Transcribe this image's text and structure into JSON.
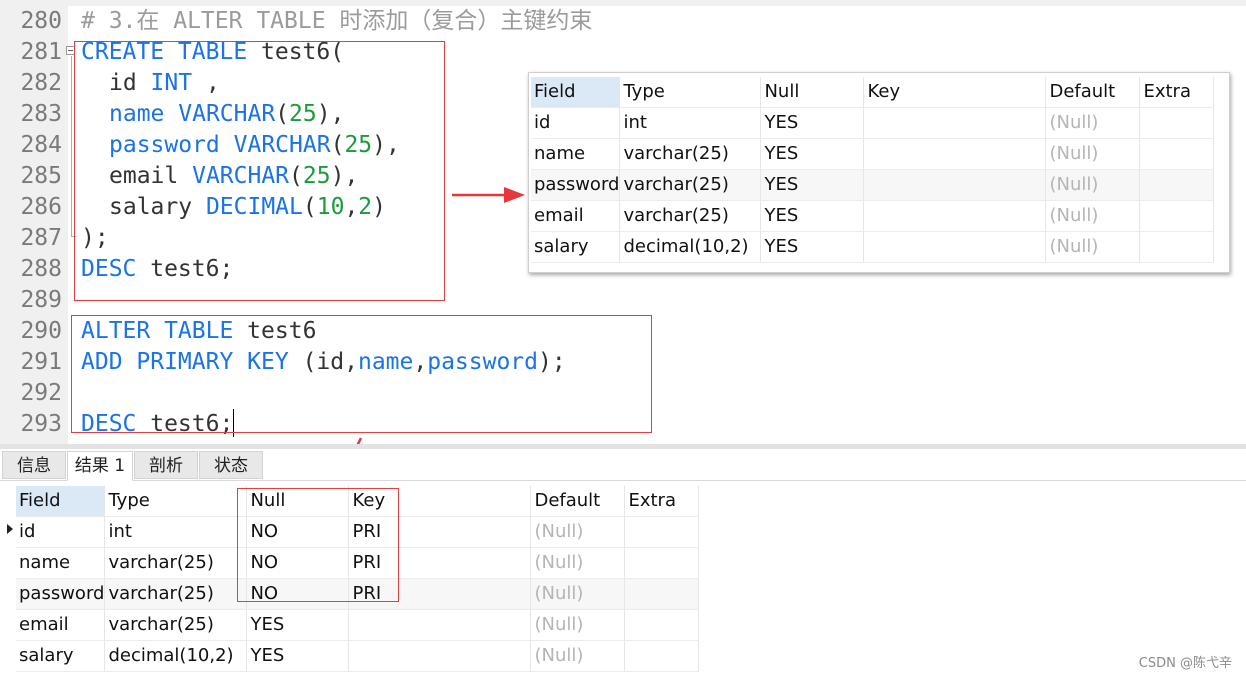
{
  "editor": {
    "lines": [
      {
        "num": "280",
        "parts": [
          {
            "t": "# 3.在 ALTER TABLE 时添加（复合）主键约束",
            "c": "cm"
          }
        ]
      },
      {
        "num": "281",
        "parts": [
          {
            "t": "CREATE TABLE",
            "c": "kw"
          },
          {
            "t": " test6(",
            "c": ""
          }
        ]
      },
      {
        "num": "282",
        "indent": true,
        "parts": [
          {
            "t": "id ",
            "c": ""
          },
          {
            "t": "INT",
            "c": "kw"
          },
          {
            "t": " ,",
            "c": ""
          }
        ]
      },
      {
        "num": "283",
        "indent": true,
        "parts": [
          {
            "t": "name",
            "c": "kw"
          },
          {
            "t": " ",
            "c": ""
          },
          {
            "t": "VARCHAR",
            "c": "kw"
          },
          {
            "t": "(",
            "c": ""
          },
          {
            "t": "25",
            "c": "num"
          },
          {
            "t": "),",
            "c": ""
          }
        ]
      },
      {
        "num": "284",
        "indent": true,
        "parts": [
          {
            "t": "password",
            "c": "kw"
          },
          {
            "t": " ",
            "c": ""
          },
          {
            "t": "VARCHAR",
            "c": "kw"
          },
          {
            "t": "(",
            "c": ""
          },
          {
            "t": "25",
            "c": "num"
          },
          {
            "t": "),",
            "c": ""
          }
        ]
      },
      {
        "num": "285",
        "indent": true,
        "parts": [
          {
            "t": "email ",
            "c": ""
          },
          {
            "t": "VARCHAR",
            "c": "kw"
          },
          {
            "t": "(",
            "c": ""
          },
          {
            "t": "25",
            "c": "num"
          },
          {
            "t": "),",
            "c": ""
          }
        ]
      },
      {
        "num": "286",
        "indent": true,
        "parts": [
          {
            "t": "salary ",
            "c": ""
          },
          {
            "t": "DECIMAL",
            "c": "kw"
          },
          {
            "t": "(",
            "c": ""
          },
          {
            "t": "10",
            "c": "num"
          },
          {
            "t": ",",
            "c": ""
          },
          {
            "t": "2",
            "c": "num"
          },
          {
            "t": ")",
            "c": ""
          }
        ]
      },
      {
        "num": "287",
        "parts": [
          {
            "t": ");",
            "c": ""
          }
        ]
      },
      {
        "num": "288",
        "parts": [
          {
            "t": "DESC",
            "c": "kw"
          },
          {
            "t": " test6;",
            "c": ""
          }
        ]
      },
      {
        "num": "289",
        "parts": []
      },
      {
        "num": "290",
        "parts": [
          {
            "t": "ALTER TABLE",
            "c": "kw"
          },
          {
            "t": " test6",
            "c": ""
          }
        ]
      },
      {
        "num": "291",
        "parts": [
          {
            "t": "ADD PRIMARY KEY",
            "c": "kw"
          },
          {
            "t": " (id,",
            "c": ""
          },
          {
            "t": "name",
            "c": "kw"
          },
          {
            "t": ",",
            "c": ""
          },
          {
            "t": "password",
            "c": "kw"
          },
          {
            "t": ");",
            "c": ""
          }
        ]
      },
      {
        "num": "292",
        "parts": []
      },
      {
        "num": "293",
        "parts": [
          {
            "t": "DESC",
            "c": "kw"
          },
          {
            "t": " test6;",
            "c": ""
          }
        ]
      }
    ]
  },
  "popup_table": {
    "headers": [
      "Field",
      "Type",
      "Null",
      "Key",
      "Default",
      "Extra"
    ],
    "rows": [
      [
        "id",
        "int",
        "YES",
        "",
        "(Null)",
        ""
      ],
      [
        "name",
        "varchar(25)",
        "YES",
        "",
        "(Null)",
        ""
      ],
      [
        "password",
        "varchar(25)",
        "YES",
        "",
        "(Null)",
        ""
      ],
      [
        "email",
        "varchar(25)",
        "YES",
        "",
        "(Null)",
        ""
      ],
      [
        "salary",
        "decimal(10,2)",
        "YES",
        "",
        "(Null)",
        ""
      ]
    ]
  },
  "result_tabs": [
    {
      "label": "信息",
      "active": false
    },
    {
      "label": "结果 1",
      "active": true
    },
    {
      "label": "剖析",
      "active": false
    },
    {
      "label": "状态",
      "active": false
    }
  ],
  "result_table": {
    "headers": [
      "Field",
      "Type",
      "Null",
      "Key",
      "Default",
      "Extra"
    ],
    "rows": [
      [
        "id",
        "int",
        "NO",
        "PRI",
        "(Null)",
        ""
      ],
      [
        "name",
        "varchar(25)",
        "NO",
        "PRI",
        "(Null)",
        ""
      ],
      [
        "password",
        "varchar(25)",
        "NO",
        "PRI",
        "(Null)",
        ""
      ],
      [
        "email",
        "varchar(25)",
        "YES",
        "",
        "(Null)",
        ""
      ],
      [
        "salary",
        "decimal(10,2)",
        "YES",
        "",
        "(Null)",
        ""
      ]
    ]
  },
  "watermark": "CSDN @陈弋辛",
  "colors": {
    "keyword": "#1a73e8",
    "number": "#1a9c3a",
    "comment": "#9b9b9b",
    "annotation": "#e04040"
  }
}
